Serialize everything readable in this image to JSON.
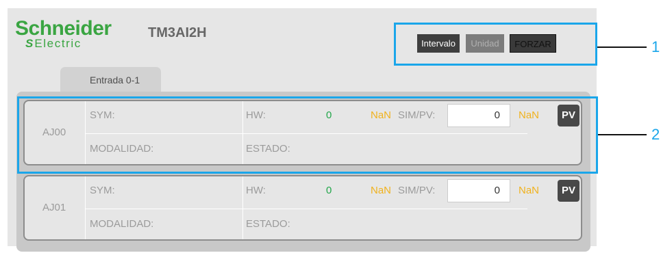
{
  "header": {
    "logo_top": "Schneider",
    "logo_bottom": "Electric",
    "logo_mark": "S",
    "device_name": "TM3AI2H"
  },
  "toolbar": {
    "intervalo_label": "Intervalo",
    "unidad_label": "Unidad",
    "forzar_label": "FORZAR"
  },
  "tabs": [
    {
      "label": "Entrada 0-1"
    }
  ],
  "channels": [
    {
      "name": "AJ00",
      "sym_label": "SYM:",
      "modalidad_label": "MODALIDAD:",
      "hw_label": "HW:",
      "hw_value": "0",
      "hw_unit": "NaN",
      "sim_label": "SIM/PV:",
      "sim_value": "0",
      "sim_unit": "NaN",
      "pv_label": "PV",
      "estado_label": "ESTADO:"
    },
    {
      "name": "AJ01",
      "sym_label": "SYM:",
      "modalidad_label": "MODALIDAD:",
      "hw_label": "HW:",
      "hw_value": "0",
      "hw_unit": "NaN",
      "sim_label": "SIM/PV:",
      "sim_value": "0",
      "sim_unit": "NaN",
      "pv_label": "PV",
      "estado_label": "ESTADO:"
    }
  ],
  "callouts": [
    "1",
    "2"
  ],
  "colors": {
    "brand_green": "#3aa542",
    "value_green": "#22a64a",
    "unit_orange": "#f0b21e",
    "highlight_blue": "#1aa6ea"
  }
}
